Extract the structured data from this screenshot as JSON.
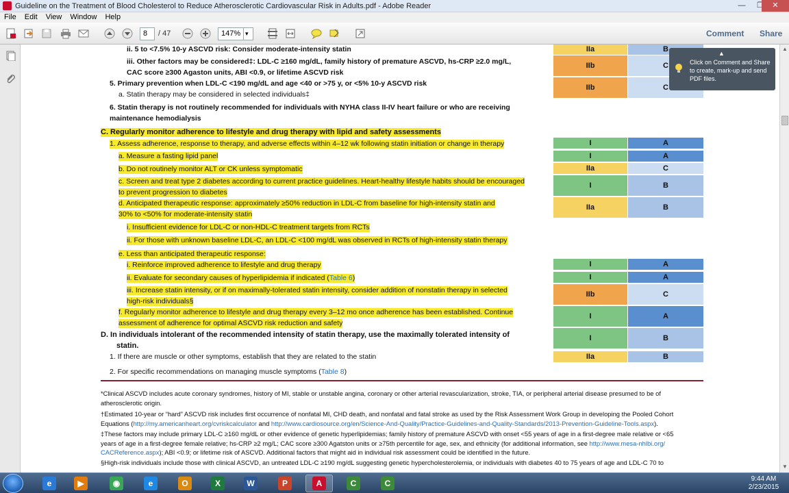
{
  "window": {
    "title": "Guideline on the Treatment of Blood Cholesterol to Reduce Atherosclerotic Cardiovascular Risk in Adults.pdf - Adobe Reader",
    "minimize": "—",
    "maximize": "❐",
    "close": "✕"
  },
  "menu": [
    "File",
    "Edit",
    "View",
    "Window",
    "Help"
  ],
  "toolbar": {
    "page_current": "8",
    "page_total": "/ 47",
    "zoom": "147%",
    "zoom_arrow": "▾",
    "comment_label": "Comment",
    "share_label": "Share"
  },
  "tooltip": {
    "text": "Click on Comment and Share to create, mark-up and send PDF files.",
    "caret": "▲"
  },
  "document": {
    "lines": [
      {
        "text": "ii. 5 to <7.5% 10-y ASCVD risk: Consider moderate-intensity statin"
      },
      {
        "text": "iii. Other factors may be considered‡: LDL-C ≥160 mg/dL, family history of premature ASCVD, hs-CRP ≥2.0 mg/L,"
      },
      {
        "text": "CAC score ≥300 Agaston units, ABI <0.9, or lifetime ASCVD risk"
      },
      {
        "text": "5. Primary prevention when LDL-C <190 mg/dL and age <40 or >75 y, or <5% 10-y ASCVD risk"
      },
      {
        "text": "a. Statin therapy may be considered in selected individuals‡"
      },
      {
        "text": "6. Statin therapy is not routinely recommended for individuals with NYHA class II-IV heart failure or who are receiving"
      },
      {
        "text": "maintenance hemodialysis"
      },
      {
        "text": "C. Regularly monitor adherence to lifestyle and drug therapy with lipid and safety assessments"
      },
      {
        "text": "1. Assess adherence, response to therapy, and adverse effects within 4–12 wk following statin initiation or change in therapy"
      },
      {
        "text": "a. Measure a fasting lipid panel"
      },
      {
        "text": "b. Do not routinely monitor ALT or CK unless symptomatic"
      },
      {
        "text": "c. Screen and treat type 2 diabetes according to current practice guidelines. Heart-healthy lifestyle habits should be encouraged"
      },
      {
        "text": "to prevent progression to diabetes"
      },
      {
        "text": "d. Anticipated therapeutic response: approximately ≥50% reduction in LDL-C from baseline for high-intensity statin and"
      },
      {
        "text": "30% to <50% for moderate-intensity statin"
      },
      {
        "text": "i. Insufficient evidence for LDL-C or non-HDL-C treatment targets from RCTs"
      },
      {
        "text": "ii. For those with unknown baseline LDL-C, an LDL-C <100 mg/dL was observed in RCTs of high-intensity statin therapy"
      },
      {
        "text": "e. Less than anticipated therapeutic response:"
      },
      {
        "text": "i. Reinforce improved adherence to lifestyle and drug therapy"
      },
      {
        "text": "ii. Evaluate for secondary causes of hyperlipidemia if indicated ("
      },
      {
        "text": "iii. Increase statin intensity, or if on maximally-tolerated statin intensity, consider addition of nonstatin therapy in selected"
      },
      {
        "text": "high-risk individuals§"
      },
      {
        "text": "f. Regularly monitor adherence to lifestyle and drug therapy every 3–12 mo once adherence has been established. Continue"
      },
      {
        "text": "assessment of adherence for optimal ASCVD risk reduction and safety"
      },
      {
        "text": "D. In individuals intolerant of the recommended intensity of statin therapy, use the maximally tolerated intensity of"
      },
      {
        "text": "statin."
      },
      {
        "text": "1. If there are muscle or other symptoms, establish that they are related to the statin"
      },
      {
        "text": "2. For specific recommendations on managing muscle symptoms ("
      }
    ],
    "link_table6": "Table 6",
    "link_table8": "Table 8",
    "close_paren": ")",
    "grades": [
      {
        "cor": "IIa",
        "loe": "B"
      },
      {
        "cor": "IIb",
        "loe": "C"
      },
      {
        "cor": "IIb",
        "loe": "C"
      },
      {
        "cor": "I",
        "loe": "A"
      },
      {
        "cor": "I",
        "loe": "A"
      },
      {
        "cor": "IIa",
        "loe": "C"
      },
      {
        "cor": "I",
        "loe": "B"
      },
      {
        "cor": "IIa",
        "loe": "B"
      },
      {
        "cor": "I",
        "loe": "A"
      },
      {
        "cor": "I",
        "loe": "A"
      },
      {
        "cor": "IIb",
        "loe": "C"
      },
      {
        "cor": "I",
        "loe": "A"
      },
      {
        "cor": "I",
        "loe": "B"
      },
      {
        "cor": "IIa",
        "loe": "B"
      }
    ],
    "footnotes": [
      {
        "text": "*Clinical ASCVD includes acute coronary syndromes, history of MI, stable or unstable angina, coronary or other arterial revascularization, stroke, TIA, or peripheral arterial disease presumed to be of"
      },
      {
        "text": "atherosclerotic origin."
      },
      {
        "text": "†Estimated 10-year or “hard” ASCVD risk includes first occurrence of nonfatal MI, CHD death, and nonfatal and fatal stroke as used by the Risk Assessment Work Group in developing the Pooled Cohort"
      },
      {
        "text": "Equations (",
        "url1": "http://my.americanheart.org/cvriskcalculator",
        "mid": " and ",
        "url2": "http://www.cardiosource.org/en/Science-And-Quality/Practice-Guidelines-and-Quality-Standards/2013-Prevention-Guideline-Tools.aspx",
        "end": ")."
      },
      {
        "text": "‡These factors may include primary LDL-C ≥160 mg/dL or other evidence of genetic hyperlipidemias; family history of premature ASCVD with onset <55 years of age in a first-degree male relative or <65"
      },
      {
        "text": "years of age in a first-degree female relative; hs-CRP ≥2 mg/L; CAC score ≥300 Agatston units or ≥75th percentile for age, sex, and ethnicity (for additional information, see ",
        "url1": "http://www.mesa-nhlbi.org/"
      },
      {
        "text": "",
        "url1": "CACReference.aspx",
        "end": "); ABI <0.9; or lifetime risk of ASCVD. Additional factors that might aid in individual risk assessment could be identified in the future."
      },
      {
        "text": "§High-risk individuals include those with clinical ASCVD, an untreated LDL-C ≥190 mg/dL suggesting genetic hypercholesterolemia, or individuals with diabetes 40 to 75 years of age and LDL-C 70 to"
      }
    ]
  },
  "taskbar": {
    "clock_time": "9:44 AM",
    "clock_date": "2/23/2015",
    "apps": [
      {
        "name": "ie",
        "label": "e",
        "color": "#2b7bd6"
      },
      {
        "name": "media",
        "label": "▶",
        "color": "#e07b10"
      },
      {
        "name": "chrome",
        "label": "◉",
        "color": "#3aa757"
      },
      {
        "name": "ie2",
        "label": "e",
        "color": "#1e88e5"
      },
      {
        "name": "outlook",
        "label": "O",
        "color": "#d98a12"
      },
      {
        "name": "excel",
        "label": "X",
        "color": "#1f7a3d"
      },
      {
        "name": "word",
        "label": "W",
        "color": "#2b5797"
      },
      {
        "name": "powerpoint",
        "label": "P",
        "color": "#c8442b"
      },
      {
        "name": "acrobat",
        "label": "A",
        "color": "#c8102e"
      },
      {
        "name": "camtasia",
        "label": "C",
        "color": "#3c8a3a"
      },
      {
        "name": "camtasia2",
        "label": "C",
        "color": "#3c8a3a"
      }
    ]
  }
}
